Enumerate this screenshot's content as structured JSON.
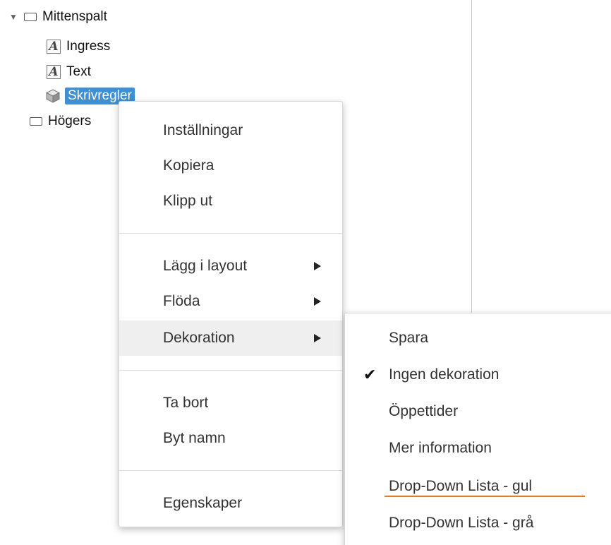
{
  "tree": {
    "items": [
      {
        "label": "Mittenspalt",
        "icon": "container-icon",
        "expanded": true
      },
      {
        "label": "Ingress",
        "icon": "text-block-icon"
      },
      {
        "label": "Text",
        "icon": "text-block-icon"
      },
      {
        "label": "Skrivregler",
        "icon": "cube-icon",
        "selected": true
      },
      {
        "label": "Högers",
        "icon": "container-icon"
      }
    ],
    "toggle_glyph": "▼"
  },
  "context_menu": {
    "group1": [
      "Inställningar",
      "Kopiera",
      "Klipp ut"
    ],
    "group2": [
      "Lägg i layout",
      "Flöda",
      "Dekoration"
    ],
    "group3": [
      "Ta bort",
      "Byt namn"
    ],
    "group4": [
      "Egenskaper"
    ],
    "hovered": "Dekoration"
  },
  "submenu": {
    "items": [
      "Spara",
      "Ingen dekoration",
      "Öppettider",
      "Mer information",
      "Drop-Down Lista - gul",
      "Drop-Down Lista - grå"
    ],
    "checked": "Ingen dekoration",
    "check_glyph": "✔",
    "underline_color": "#f07a1a"
  },
  "colors": {
    "selection": "#3d8fd6",
    "hover": "#efefef"
  }
}
